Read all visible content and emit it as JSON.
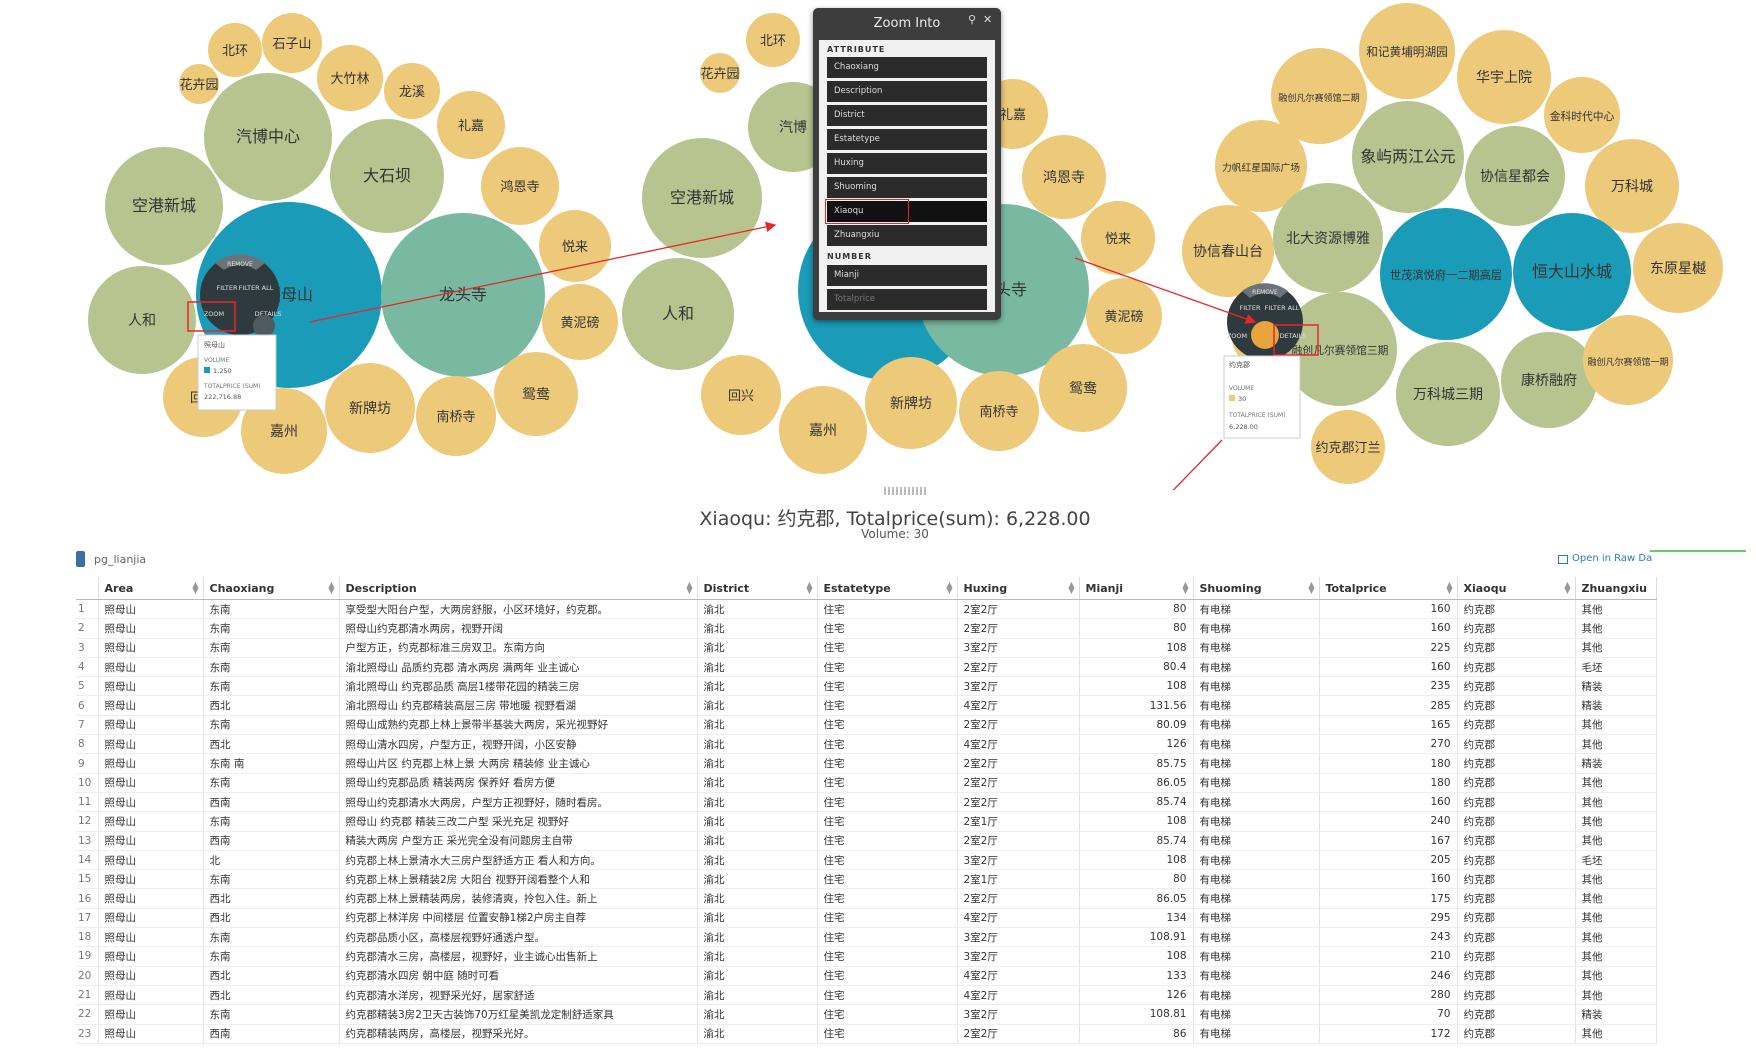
{
  "clusters": [
    {
      "bubbles": [
        {
          "label": "北环",
          "color": "#edc97a"
        },
        {
          "label": "石子山",
          "color": "#edc97a"
        },
        {
          "label": "花卉园",
          "color": "#edc97a"
        },
        {
          "label": "大竹林",
          "color": "#edc97a"
        },
        {
          "label": "龙溪",
          "color": "#edc97a"
        },
        {
          "label": "汽博中心",
          "color": "#b7c48f"
        },
        {
          "label": "礼嘉",
          "color": "#edc97a"
        },
        {
          "label": "大石坝",
          "color": "#b7c48f"
        },
        {
          "label": "鸿恩寺",
          "color": "#edc97a"
        },
        {
          "label": "空港新城",
          "color": "#b7c48f"
        },
        {
          "label": "悦来",
          "color": "#edc97a"
        },
        {
          "label": "照母山",
          "color": "#1a9bb7"
        },
        {
          "label": "龙头寺",
          "color": "#79b9a2"
        },
        {
          "label": "人和",
          "color": "#b7c48f"
        },
        {
          "label": "黄泥磅",
          "color": "#edc97a"
        },
        {
          "label": "鸳鸯",
          "color": "#edc97a"
        },
        {
          "label": "回兴",
          "color": "#edc97a"
        },
        {
          "label": "新牌坊",
          "color": "#edc97a"
        },
        {
          "label": "南桥寺",
          "color": "#edc97a"
        },
        {
          "label": "嘉州",
          "color": "#edc97a"
        }
      ]
    },
    {
      "bubbles": [
        {
          "label": "北环",
          "color": "#edc97a"
        },
        {
          "label": "花卉园",
          "color": "#edc97a"
        },
        {
          "label": "汽博",
          "color": "#b7c48f"
        },
        {
          "label": "礼嘉",
          "color": "#edc97a"
        },
        {
          "label": "鸿恩寺",
          "color": "#edc97a"
        },
        {
          "label": "空港新城",
          "color": "#b7c48f"
        },
        {
          "label": "悦来",
          "color": "#edc97a"
        },
        {
          "label": "",
          "color": "#1a9bb7"
        },
        {
          "label": "龙头寺",
          "color": "#79b9a2"
        },
        {
          "label": "人和",
          "color": "#b7c48f"
        },
        {
          "label": "黄泥磅",
          "color": "#edc97a"
        },
        {
          "label": "鸳鸯",
          "color": "#edc97a"
        },
        {
          "label": "回兴",
          "color": "#edc97a"
        },
        {
          "label": "新牌坊",
          "color": "#edc97a"
        },
        {
          "label": "南桥寺",
          "color": "#edc97a"
        },
        {
          "label": "嘉州",
          "color": "#edc97a"
        }
      ]
    },
    {
      "bubbles": [
        {
          "label": "和记黄埔明湖园",
          "color": "#edc97a"
        },
        {
          "label": "融创凡尔赛领馆二期",
          "color": "#edc97a"
        },
        {
          "label": "华宇上院",
          "color": "#edc97a"
        },
        {
          "label": "金科时代中心",
          "color": "#edc97a"
        },
        {
          "label": "力帆红星国际广场",
          "color": "#edc97a"
        },
        {
          "label": "象屿两江公元",
          "color": "#b7c48f"
        },
        {
          "label": "协信星都会",
          "color": "#b7c48f"
        },
        {
          "label": "万科城",
          "color": "#edc97a"
        },
        {
          "label": "北大资源博雅",
          "color": "#b7c48f"
        },
        {
          "label": "协信春山台",
          "color": "#edc97a"
        },
        {
          "label": "世茂滨悦府一二期高层",
          "color": "#1a9bb7"
        },
        {
          "label": "恒大山水城",
          "color": "#1a9bb7"
        },
        {
          "label": "东原星樾",
          "color": "#edc97a"
        },
        {
          "label": "约克郡",
          "color": "#edc97a"
        },
        {
          "label": "融创凡尔赛领馆三期",
          "color": "#b7c48f"
        },
        {
          "label": "万科城三期",
          "color": "#b7c48f"
        },
        {
          "label": "康桥融府",
          "color": "#b7c48f"
        },
        {
          "label": "融创凡尔赛领馆一期",
          "color": "#edc97a"
        },
        {
          "label": "约克郡汀兰",
          "color": "#edc97a"
        }
      ]
    }
  ],
  "radial_menus": [
    {
      "remove": "REMOVE",
      "filter": "FILTER",
      "filter_all": "FILTER ALL",
      "zoom": "ZOOM",
      "details": "DETAILS",
      "tooltip": {
        "name": "照母山",
        "volume_label": "VOLUME",
        "volume": "1,250",
        "total_label": "TOTALPRICE (SUM)",
        "total": "222,716.88"
      }
    },
    {
      "remove": "REMOVE",
      "filter": "FILTER",
      "filter_all": "FILTER ALL",
      "zoom": "ZOOM",
      "details": "DETAILS",
      "tooltip": {
        "name": "约克郡",
        "volume_label": "VOLUME",
        "volume": "30",
        "total_label": "TOTALPRICE (SUM)",
        "total": "6,228.00"
      }
    }
  ],
  "zoom_menu": {
    "title": "Zoom Into",
    "search_icon": "search-icon",
    "close_icon": "close-icon",
    "attribute_section": "ATTRIBUTE",
    "attributes": [
      "Chaoxiang",
      "Description",
      "District",
      "Estatetype",
      "Huxing",
      "Shuoming",
      "Xiaoqu",
      "Zhuangxiu"
    ],
    "selected": "Xiaoqu",
    "number_section": "NUMBER",
    "numbers": [
      "Mianji",
      "Totalprice"
    ]
  },
  "summary": {
    "title": "Xiaoqu: 约克郡, Totalprice(sum): 6,228.00",
    "volume": "Volume: 30"
  },
  "table_name": "pg_lianjia",
  "open_raw_label": "Open in Raw Da",
  "colors": {
    "teal": "#1a9bb7",
    "sea": "#79b9a2",
    "olive": "#b7c48f",
    "sand": "#edc97a",
    "annotation": "#e8262a",
    "link": "#2a7ab8"
  },
  "columns": [
    "Area",
    "Chaoxiang",
    "Description",
    "District",
    "Estatetype",
    "Huxing",
    "Mianji",
    "Shuoming",
    "Totalprice",
    "Xiaoqu",
    "Zhuangxiu"
  ],
  "rows": [
    [
      "1",
      "照母山",
      "东南",
      "享受型大阳台户型，大两房舒服，小区环境好，约克郡。",
      "渝北",
      "住宅",
      "2室2厅",
      "80",
      "有电梯",
      "160",
      "约克郡",
      "其他"
    ],
    [
      "2",
      "照母山",
      "东南",
      "照母山约克郡清水两房，视野开阔",
      "渝北",
      "住宅",
      "2室2厅",
      "80",
      "有电梯",
      "160",
      "约克郡",
      "其他"
    ],
    [
      "3",
      "照母山",
      "东南",
      "户型方正，约克郡标准三房双卫。东南方向",
      "渝北",
      "住宅",
      "3室2厅",
      "108",
      "有电梯",
      "225",
      "约克郡",
      "其他"
    ],
    [
      "4",
      "照母山",
      "东南",
      "渝北照母山 品质约克郡 清水两房 满两年 业主诚心",
      "渝北",
      "住宅",
      "2室2厅",
      "80.4",
      "有电梯",
      "160",
      "约克郡",
      "毛坯"
    ],
    [
      "5",
      "照母山",
      "东南",
      "渝北照母山 约克郡品质 高层1楼带花园的精装三房",
      "渝北",
      "住宅",
      "3室2厅",
      "108",
      "有电梯",
      "235",
      "约克郡",
      "精装"
    ],
    [
      "6",
      "照母山",
      "西北",
      "渝北照母山 约克郡精装高层三房 带地暖 视野看湖",
      "渝北",
      "住宅",
      "4室2厅",
      "131.56",
      "有电梯",
      "285",
      "约克郡",
      "精装"
    ],
    [
      "7",
      "照母山",
      "东南",
      "照母山成熟约克郡上林上景带半基装大两房，采光视野好",
      "渝北",
      "住宅",
      "2室2厅",
      "80.09",
      "有电梯",
      "165",
      "约克郡",
      "其他"
    ],
    [
      "8",
      "照母山",
      "西北",
      "照母山清水四房，户型方正，视野开阔，小区安静",
      "渝北",
      "住宅",
      "4室2厅",
      "126",
      "有电梯",
      "270",
      "约克郡",
      "其他"
    ],
    [
      "9",
      "照母山",
      "东南 南",
      "照母山片区 约克郡上林上景 大两房 精装修 业主诚心",
      "渝北",
      "住宅",
      "2室2厅",
      "85.75",
      "有电梯",
      "180",
      "约克郡",
      "精装"
    ],
    [
      "10",
      "照母山",
      "东南",
      "照母山约克郡品质 精装两房 保养好 看房方便",
      "渝北",
      "住宅",
      "2室2厅",
      "86.05",
      "有电梯",
      "180",
      "约克郡",
      "其他"
    ],
    [
      "11",
      "照母山",
      "西南",
      "照母山约克郡清水大两房，户型方正视野好，随时看房。",
      "渝北",
      "住宅",
      "2室2厅",
      "85.74",
      "有电梯",
      "160",
      "约克郡",
      "其他"
    ],
    [
      "12",
      "照母山",
      "东南",
      "照母山 约克郡 精装三改二户型 采光充足 视野好",
      "渝北",
      "住宅",
      "2室1厅",
      "108",
      "有电梯",
      "240",
      "约克郡",
      "其他"
    ],
    [
      "13",
      "照母山",
      "西南",
      "精装大两房 户型方正 采光完全没有问题房主自带",
      "渝北",
      "住宅",
      "2室2厅",
      "85.74",
      "有电梯",
      "167",
      "约克郡",
      "其他"
    ],
    [
      "14",
      "照母山",
      "北",
      "约克郡上林上景清水大三房户型舒适方正 看人和方向。",
      "渝北",
      "住宅",
      "3室2厅",
      "108",
      "有电梯",
      "205",
      "约克郡",
      "毛坯"
    ],
    [
      "15",
      "照母山",
      "东南",
      "约克郡上林上景精装2房 大阳台 视野开阔看整个人和",
      "渝北",
      "住宅",
      "2室1厅",
      "80",
      "有电梯",
      "160",
      "约克郡",
      "其他"
    ],
    [
      "16",
      "照母山",
      "西北",
      "约克郡上林上景精装两房，装修清爽，拎包入住。新上",
      "渝北",
      "住宅",
      "2室2厅",
      "86.05",
      "有电梯",
      "175",
      "约克郡",
      "其他"
    ],
    [
      "17",
      "照母山",
      "西北",
      "约克郡上林洋房 中间楼层 位置安静1梯2户房主自荐",
      "渝北",
      "住宅",
      "4室2厅",
      "134",
      "有电梯",
      "295",
      "约克郡",
      "其他"
    ],
    [
      "18",
      "照母山",
      "东南",
      "约克郡品质小区，高楼层视野好通透户型。",
      "渝北",
      "住宅",
      "3室2厅",
      "108.91",
      "有电梯",
      "243",
      "约克郡",
      "其他"
    ],
    [
      "19",
      "照母山",
      "东南",
      "约克郡清水三房，高楼层，视野好，业主诚心出售新上",
      "渝北",
      "住宅",
      "3室2厅",
      "108",
      "有电梯",
      "210",
      "约克郡",
      "其他"
    ],
    [
      "20",
      "照母山",
      "西北",
      "约克郡清水四房 朝中庭 随时可看",
      "渝北",
      "住宅",
      "4室2厅",
      "133",
      "有电梯",
      "246",
      "约克郡",
      "其他"
    ],
    [
      "21",
      "照母山",
      "西北",
      "约克郡清水洋房，视野采光好，居家舒适",
      "渝北",
      "住宅",
      "4室2厅",
      "126",
      "有电梯",
      "280",
      "约克郡",
      "其他"
    ],
    [
      "22",
      "照母山",
      "东南",
      "约克郡精装3房2卫天古装饰70万红星美凯龙定制舒适家具",
      "渝北",
      "住宅",
      "3室2厅",
      "108.81",
      "有电梯",
      "70",
      "约克郡",
      "精装"
    ],
    [
      "23",
      "照母山",
      "西南",
      "约克郡精装两房，高楼层，视野采光好。",
      "渝北",
      "住宅",
      "2室2厅",
      "86",
      "有电梯",
      "172",
      "约克郡",
      "其他"
    ]
  ]
}
